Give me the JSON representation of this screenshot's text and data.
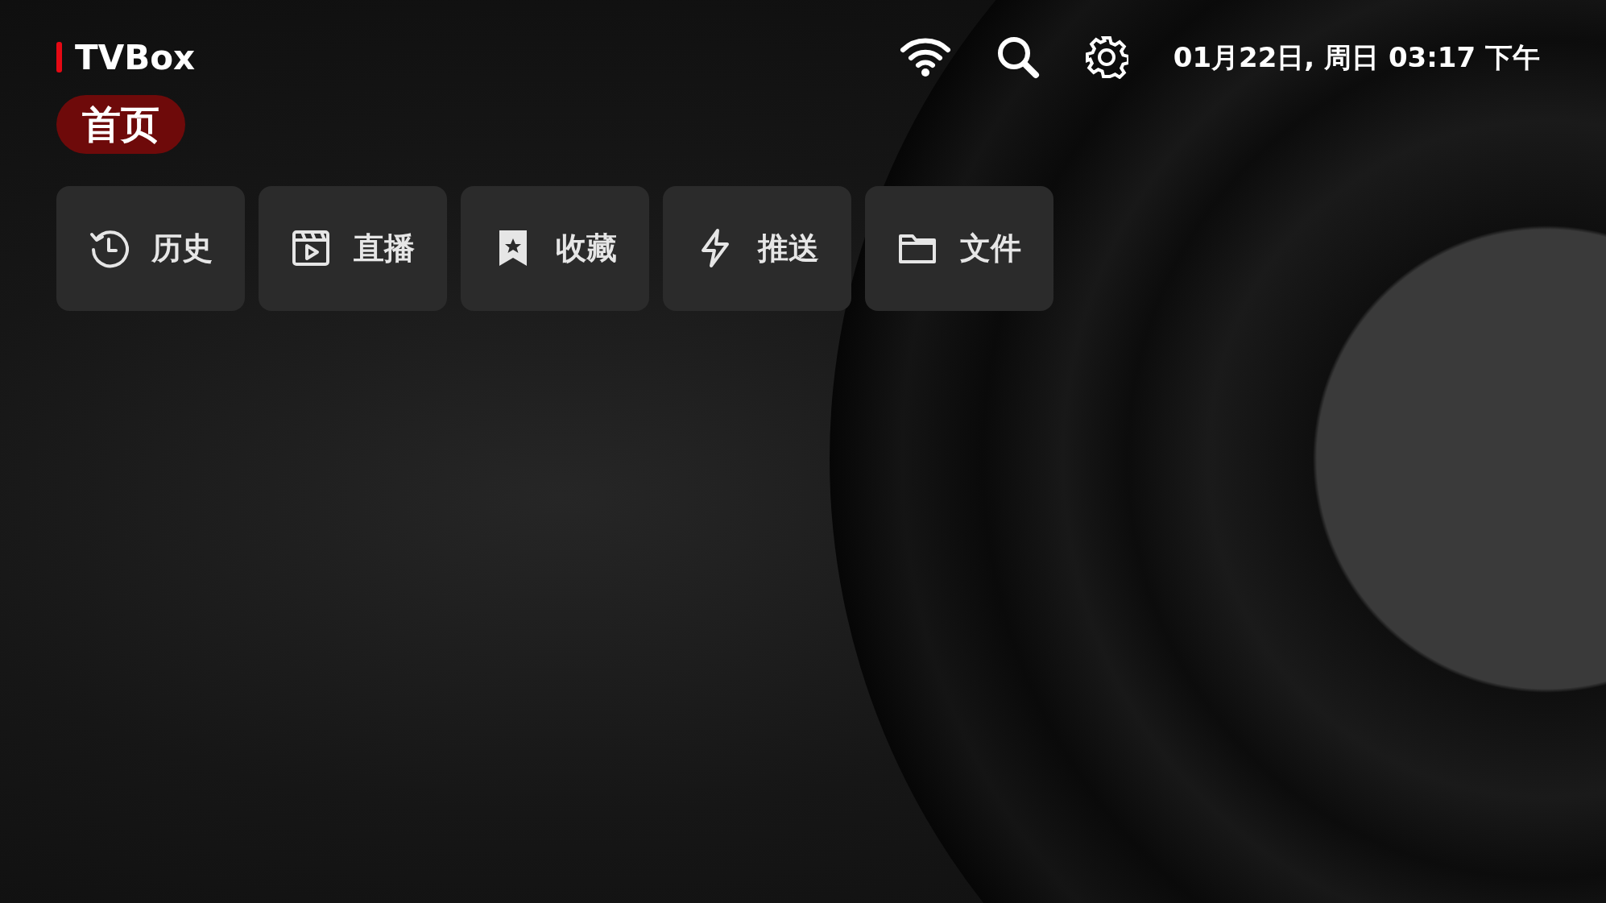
{
  "app": {
    "title": "TVBox"
  },
  "status": {
    "datetime": "01月22日, 周日 03:17 下午"
  },
  "tabs": [
    {
      "label": "首页",
      "selected": true
    }
  ],
  "tiles": [
    {
      "label": "历史"
    },
    {
      "label": "直播"
    },
    {
      "label": "收藏"
    },
    {
      "label": "推送"
    },
    {
      "label": "文件"
    }
  ]
}
